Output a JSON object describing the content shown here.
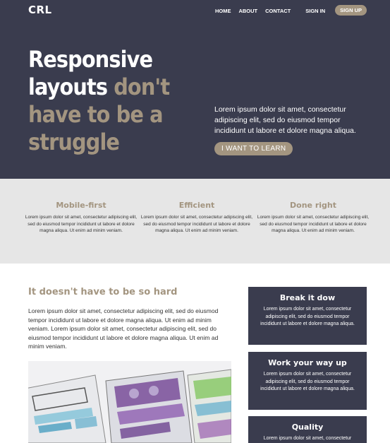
{
  "nav": {
    "logo": "CRL",
    "links": [
      "HOME",
      "ABOUT",
      "CONTACT"
    ],
    "sign_in": "SIGN IN",
    "sign_up": "SIGN UP"
  },
  "hero": {
    "title_line1": "Responsive",
    "title_line2_white": "layouts",
    "title_line2_accent": "don't",
    "title_line3": "have to be a",
    "title_line4": "struggle",
    "text": "Lorem ipsum dolor sit amet, consectetur adipiscing elit, sed do eiusmod tempor incididunt ut labore et dolore magna aliqua.",
    "button": "I WANT TO LEARN"
  },
  "features": [
    {
      "title": "Mobile-first",
      "text": "Lorem ipsum dolor sit amet, consectetur adipiscing elit, sed do eiusmod tempor incididunt ut labore et dolore magna aliqua. Ut enim ad minim veniam."
    },
    {
      "title": "Efficient",
      "text": "Lorem ipsum dolor sit amet, consectetur adipiscing elit, sed do eiusmod tempor incididunt ut labore et dolore magna aliqua. Ut enim ad minim veniam."
    },
    {
      "title": "Done right",
      "text": "Lorem ipsum dolor sit amet, consectetur adipiscing elit, sed do eiusmod tempor incididunt ut labore et dolore magna aliqua. Ut enim ad minim veniam."
    }
  ],
  "main": {
    "title": "It doesn't have to be so hard",
    "text": "Lorem ipsum dolor sit amet, consectetur adipiscing elit, sed do eiusmod tempor incididunt ut labore et dolore magna aliqua. Ut enim ad minim veniam. Lorem ipsum dolor sit amet, consectetur adipiscing elit, sed do eiusmod tempor incididunt ut labore et dolore magna aliqua. Ut enim ad minim veniam."
  },
  "cards": [
    {
      "title": "Break it dow",
      "text": "Lorem ipsum dolor sit amet, consectetur adipiscing elit, sed do eiusmod tempor incididunt ut labore et dolore magna aliqua."
    },
    {
      "title": "Work your way up",
      "text": "Lorem ipsum dolor sit amet, consectetur adipiscing elit, sed do eiusmod tempor incididunt ut labore et dolore magna aliqua."
    },
    {
      "title": "Quality",
      "text": "Lorem ipsum dolor sit amet, consectetur"
    }
  ],
  "colors": {
    "dark": "#3a3c4e",
    "accent": "#a39580",
    "light_gray": "#e6e6e6"
  }
}
